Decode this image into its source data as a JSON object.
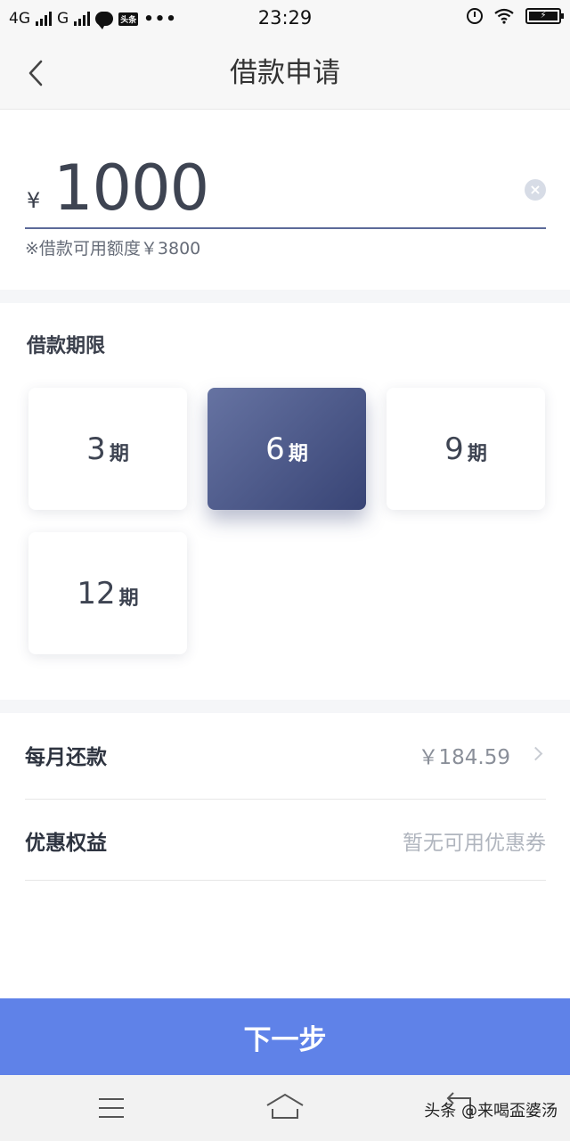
{
  "status_bar": {
    "network_1": "4G",
    "network_2": "G",
    "app_badge": "头条",
    "more": "•••",
    "time": "23:29",
    "battery_icon": "battery-charging-icon"
  },
  "header": {
    "title": "借款申请",
    "back_icon": "chevron-left-icon"
  },
  "amount": {
    "currency_symbol": "¥",
    "value": "1000",
    "clear_icon": "clear-circle-icon",
    "available_note": "※借款可用额度￥3800"
  },
  "term": {
    "title": "借款期限",
    "unit": "期",
    "options": [
      {
        "value": "3",
        "selected": false
      },
      {
        "value": "6",
        "selected": true
      },
      {
        "value": "9",
        "selected": false
      },
      {
        "value": "12",
        "selected": false
      }
    ],
    "selected_gradient": [
      "#6673a2",
      "#384475"
    ]
  },
  "details": {
    "monthly_label": "每月还款",
    "monthly_value": "￥184.59",
    "benefit_label": "优惠权益",
    "benefit_value": "暂无可用优惠券"
  },
  "next_button": {
    "label": "下一步",
    "color": "#5f82e8"
  },
  "system_nav": {
    "menu_icon": "menu-icon",
    "home_icon": "home-icon",
    "back_icon": "back-icon",
    "watermark": "头条 @来喝盃婆汤"
  }
}
